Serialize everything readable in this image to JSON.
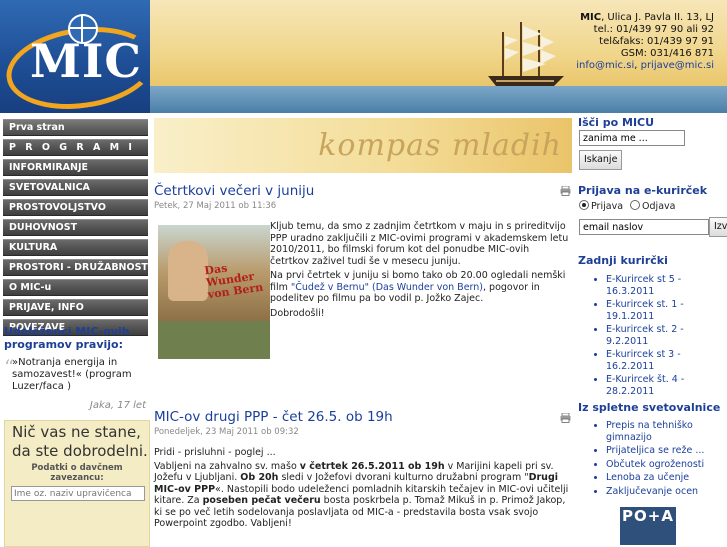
{
  "header": {
    "logo_text": "MIC",
    "contact": {
      "org": "MIC",
      "address": ", Ulica J. Pavla II. 13, LJ",
      "tel": "tel.: 01/439 97 90 ali 92",
      "telfax": "tel&faks: 01/439 97 91",
      "gsm": "GSM: 031/416 871",
      "email1": "info@mic.si",
      "email_sep": ", ",
      "email2": "prijave@mic.si"
    }
  },
  "nav": {
    "items": [
      "Prva stran",
      "P R O G R A M I",
      "INFORMIRANJE",
      "SVETOVALNICA",
      "PROSTOVOLJSTVO",
      "DUHOVNOST",
      "KULTURA",
      "PROSTORI - DRUŽABNOST",
      "O MIC-u",
      "PRIJAVE, INFO",
      "POVEZAVE"
    ]
  },
  "quote": {
    "title": "Udeleženci MIC-ovih programov pravijo:",
    "mark": "“",
    "text": "»Notranja energija in samozavest!« (program Luzer/faca )",
    "author": "Jaka, 17 let"
  },
  "donor": {
    "slogan": "Nič vas ne stane, da ste dobrodelni.",
    "label": "Podatki o davčnem zavezancu:",
    "placeholder": "Ime oz. naziv upravičenca"
  },
  "banner": {
    "kompas": "kompas mladih"
  },
  "articles": [
    {
      "title": "Četrtkovi večeri v juniju",
      "date": "Petek, 27 Maj 2011 ob 11:36",
      "para1": "Kljub temu, da smo z zadnjim četrtkom v maju in s prireditvijo PPP uradno zaključili z MIC-ovimi programi v akademskem letu 2010/2011, bo filmski forum kot del ponudbe MIC-ovih četrtkov zaživel tudi še v mesecu juniju.",
      "para2_a": "Na prvi četrtek v juniju si bomo tako ob 20.00 ogledali nemški film ",
      "para2_link": "\"Čudež v Bernu\" (Das Wunder von Bern)",
      "para2_b": ", pogovor in podelitev po filmu pa bo vodil p. Jožko Zajec.",
      "para3": "Dobrodošli!",
      "poster_title": "Das Wunder von Bern"
    },
    {
      "title": "MIC-ov drugi PPP - čet 26.5. ob 19h",
      "date": "Ponedeljek, 23 Maj 2011 ob 09:32",
      "line1": "Pridi - prisluhni - poglej ...",
      "p1": "Vabljeni na zahvalno sv. mašo ",
      "p1_bold": "v četrtek 26.5.2011 ob 19h",
      "p2": " v Marijini kapeli pri sv. Jožefu v Ljubljani. ",
      "p2_bold": "Ob 20h",
      "p3": " sledi v Jožefovi dvorani kulturno družabni program \"",
      "p3_bold": "Drugi MIC-ov PPP",
      "p4": "«. Nastopili bodo udeleženci pomladnih kitarskih tečajev in MIC-ovi učitelji kitare. Za ",
      "p4_bold": "poseben pečat večeru",
      "p5": " bosta poskrbela p. Tomaž Mikuš in p. Primož Jakop, ki se po več letih sodelovanja poslavljata od MIC-a - predstavila bosta vsak svojo Powerpoint zgodbo. Vabljeni!"
    }
  ],
  "search": {
    "title": "Išči po MICU",
    "value": "zanima me ...",
    "button": "Iskanje"
  },
  "newsletter": {
    "title": "Prijava na e-kurirček",
    "opt_subscribe": "Prijava",
    "opt_unsubscribe": "Odjava",
    "value": "email naslov",
    "button": "Izvedi"
  },
  "kurircki": {
    "title": "Zadnji kurirčki",
    "items": [
      "E-Kurircek st 5 - 16.3.2011",
      "E-kurircek st. 1 - 19.1.2011",
      "E-kurircek st. 2 - 9.2.2011",
      "E-kurircek st 3 - 16.2.2011",
      "E-Kurircek št. 4 - 28.2.2011"
    ]
  },
  "svetovalnica": {
    "title": "Iz spletne svetovalnice",
    "items": [
      "Prepis na tehniško gimnazijo",
      "Prijateljica se reže ...",
      "Občutek ogroženosti",
      "Lenoba za učenje",
      "Zaključevanje ocen"
    ]
  },
  "footer_logo": {
    "text": "PO+A"
  }
}
